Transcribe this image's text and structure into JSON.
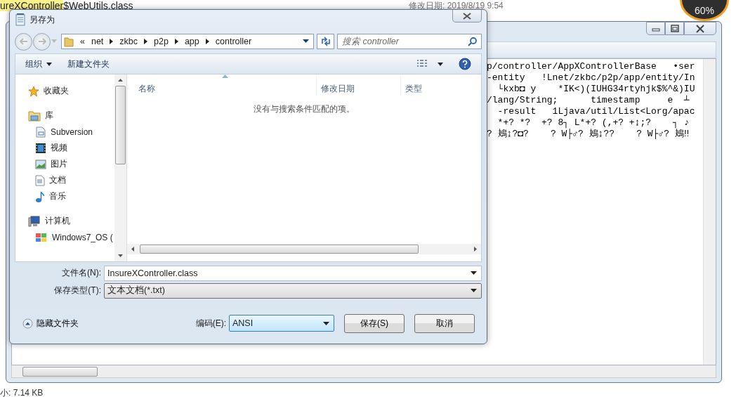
{
  "background": {
    "file_highlight": "ureXController",
    "file_rest": "$WebUtils.class",
    "modified": "修改日期: 2019/8/19 9:54",
    "size": "小: 7.14 KB",
    "gauge": "60%"
  },
  "editor": {
    "lines": [
      "p/controller/AppXControllerBase   •ser",
      "-entity   !Lnet/zkbc/p2p/app/entity/In",
      "  └kxb◘ y    *IK<)(IUHG34rtyhjk$%^&)IU",
      "/lang/String;      timestamp     e  ┴",
      "  -result   1Ljava/util/List<Lorg/apac",
      "  *+? *?  +? 8┐ L*+? (,+? +↨;?    ┐ ♪",
      "? 鴂↨?◘?    ? W├♂? 鴂↨??    ? W├♂? 鴂‼"
    ]
  },
  "dialog": {
    "title": "另存为",
    "path_prefix": "«",
    "path": [
      "net",
      "zkbc",
      "p2p",
      "app",
      "controller"
    ],
    "search": {
      "placeholder": "搜索 controller"
    },
    "toolbar": {
      "organize": "组织",
      "new_folder": "新建文件夹"
    },
    "nav": [
      {
        "label": "收藏夹",
        "kind": "star"
      },
      {
        "label": "库",
        "kind": "library",
        "children": [
          {
            "label": "Subversion",
            "kind": "svn"
          },
          {
            "label": "视频",
            "kind": "video"
          },
          {
            "label": "图片",
            "kind": "picture"
          },
          {
            "label": "文档",
            "kind": "document"
          },
          {
            "label": "音乐",
            "kind": "music"
          }
        ]
      },
      {
        "label": "计算机",
        "kind": "computer",
        "children": [
          {
            "label": "Windows7_OS (",
            "kind": "drive"
          }
        ]
      }
    ],
    "columns": [
      {
        "label": "名称",
        "sorted": true
      },
      {
        "label": "修改日期",
        "sorted": false
      },
      {
        "label": "类型",
        "sorted": false
      }
    ],
    "empty_message": "没有与搜索条件匹配的项。",
    "file_name": {
      "label": "文件名(N):",
      "value": "InsureXController.class"
    },
    "file_type": {
      "label": "保存类型(T):",
      "value": "文本文档(*.txt)"
    },
    "hide_folders": "隐藏文件夹",
    "encoding": {
      "label": "编码(E):",
      "value": "ANSI"
    },
    "buttons": [
      "保存(S)",
      "取消"
    ]
  }
}
